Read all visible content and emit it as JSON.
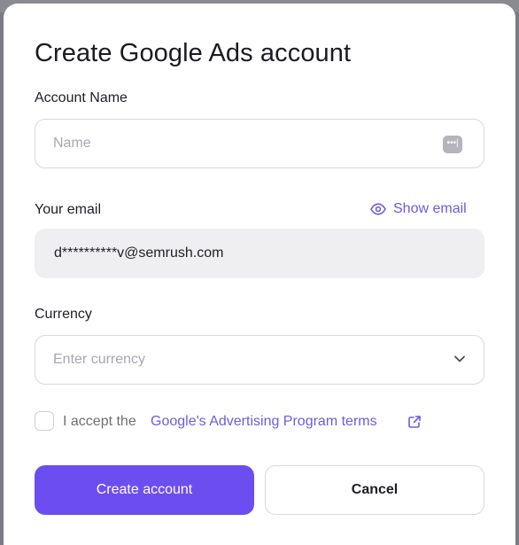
{
  "modal": {
    "title": "Create Google Ads account"
  },
  "account_name": {
    "label": "Account Name",
    "placeholder": "Name",
    "value": "",
    "icon": "password-manager-icon"
  },
  "email": {
    "label": "Your email",
    "show_label": "Show email",
    "show_icon": "eye-icon",
    "value": "d**********v@semrush.com"
  },
  "currency": {
    "label": "Currency",
    "placeholder": "Enter currency",
    "icon": "chevron-down-icon"
  },
  "terms": {
    "checked": false,
    "prefix": "I accept the",
    "link_label": "Google's Advertising Program terms",
    "link_icon": "external-link-icon"
  },
  "actions": {
    "create_label": "Create account",
    "cancel_label": "Cancel"
  },
  "colors": {
    "accent": "#6c4ef0",
    "link": "#6c5ce0",
    "overlay": "#7a7a82",
    "field_border": "#d9d9df",
    "readonly_bg": "#efeff2"
  }
}
